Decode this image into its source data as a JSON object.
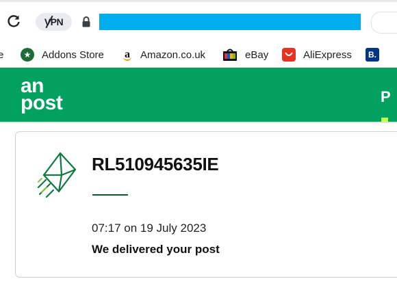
{
  "browser": {
    "vpn_label": "VPN",
    "bookmarks": [
      {
        "label": "e",
        "icon": "bookmark-cutoff"
      },
      {
        "label": "Addons Store",
        "icon": "addons-store-icon"
      },
      {
        "label": "Amazon.co.uk",
        "icon": "amazon-icon"
      },
      {
        "label": "eBay",
        "icon": "ebay-icon"
      },
      {
        "label": "AliExpress",
        "icon": "aliexpress-icon"
      },
      {
        "label": "",
        "icon": "booking-icon"
      }
    ],
    "booking_glyph": "B."
  },
  "site": {
    "logo_line1": "an",
    "logo_line2": "post",
    "header_cut_text": "P",
    "brand_color": "#02a160"
  },
  "tracking": {
    "number": "RL510945635IE",
    "time": "07:17 on 19 July 2023",
    "status": "We delivered your post",
    "icon": "envelope-delivered-icon",
    "accent_color": "#0b5a2a"
  }
}
